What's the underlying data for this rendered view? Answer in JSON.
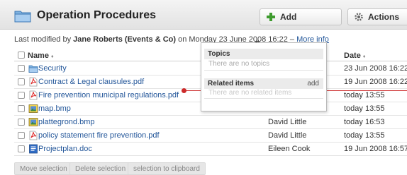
{
  "header": {
    "title": "Operation Procedures",
    "add_label": "Add",
    "actions_label": "Actions"
  },
  "modified": {
    "prefix": "Last modified by ",
    "author": "Jane Roberts (Events & Co)",
    "on_text": " on Monday 23 June 2008 16:22 – ",
    "more_info": "More info"
  },
  "table": {
    "name_header": "Name",
    "date_header": "Date",
    "sort_glyph": "♦",
    "rows": [
      {
        "icon": "folder-icon",
        "name": "Security",
        "owner": "",
        "date": "23 Jun 2008 16:22"
      },
      {
        "icon": "pdf-icon",
        "name": "Contract & Legal clausules.pdf",
        "owner": "",
        "date": "19 Jun 2008 16:22"
      },
      {
        "icon": "pdf-icon",
        "name": "Fire prevention municipal regulations.pdf",
        "owner": "",
        "date": "today 13:55"
      },
      {
        "icon": "image-icon",
        "name": "map.bmp",
        "owner": "",
        "date": "today 13:55"
      },
      {
        "icon": "image-icon",
        "name": "plattegrond.bmp",
        "owner": "David Little",
        "date": "today 16:53"
      },
      {
        "icon": "pdf-icon",
        "name": "policy statement fire prevention.pdf",
        "owner": "David Little",
        "date": "today 13:55"
      },
      {
        "icon": "doc-icon",
        "name": "Projectplan.doc",
        "owner": "Eileen Cook",
        "date": "19 Jun 2008 16:57"
      }
    ]
  },
  "popup": {
    "topics_title": "Topics",
    "topics_empty": "There are no topics",
    "related_title": "Related items",
    "related_add": "add",
    "related_empty": "There are no related items"
  },
  "footer": {
    "move": "Move selection",
    "delete": "Delete selection",
    "clipboard": "selection to clipboard"
  },
  "colors": {
    "link": "#24579a",
    "callout": "#cc2a2a",
    "add_icon": "#3e9b2e"
  }
}
